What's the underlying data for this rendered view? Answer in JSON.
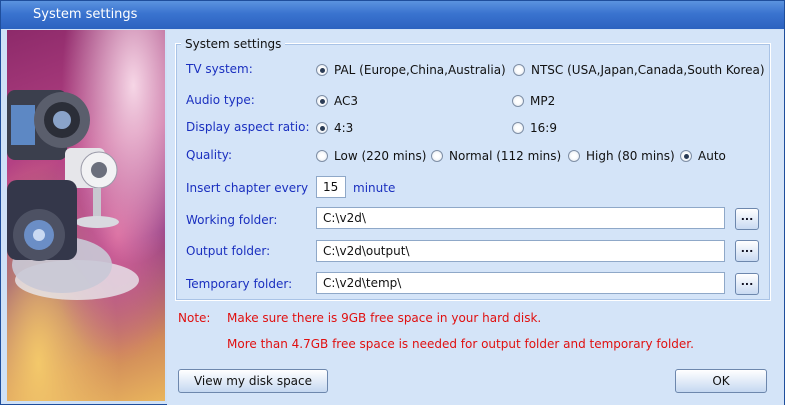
{
  "window": {
    "title": "System settings"
  },
  "group": {
    "title": "System settings"
  },
  "tv_system": {
    "label": "TV system:",
    "options": [
      "PAL (Europe,China,Australia)",
      "NTSC (USA,Japan,Canada,South Korea)"
    ],
    "selected": "PAL (Europe,China,Australia)"
  },
  "audio_type": {
    "label": "Audio type:",
    "options": [
      "AC3",
      "MP2"
    ],
    "selected": "AC3"
  },
  "aspect_ratio": {
    "label": "Display aspect ratio:",
    "options": [
      "4:3",
      "16:9"
    ],
    "selected": "4:3"
  },
  "quality": {
    "label": "Quality:",
    "options": [
      "Low (220 mins)",
      "Normal (112 mins)",
      "High (80 mins)",
      "Auto"
    ],
    "selected": "Auto"
  },
  "chapter": {
    "label": "Insert chapter every",
    "value": "15",
    "unit": "minute"
  },
  "folders": {
    "working": {
      "label": "Working folder:",
      "value": "C:\\v2d\\",
      "browse": "..."
    },
    "output": {
      "label": "Output folder:",
      "value": "C:\\v2d\\output\\",
      "browse": "..."
    },
    "temporary": {
      "label": "Temporary folder:",
      "value": "C:\\v2d\\temp\\",
      "browse": "..."
    }
  },
  "note": {
    "key": "Note:",
    "line1": "Make sure there is 9GB free space in your hard disk.",
    "line2": "More than 4.7GB free space is needed for output folder and temporary folder."
  },
  "buttons": {
    "disk_space": "View my disk space",
    "ok": "OK"
  },
  "colors": {
    "titlebar": "#3a73cf",
    "label_blue": "#1a2fbf",
    "note_red": "#e01010",
    "panel": "#d4e4f8"
  }
}
